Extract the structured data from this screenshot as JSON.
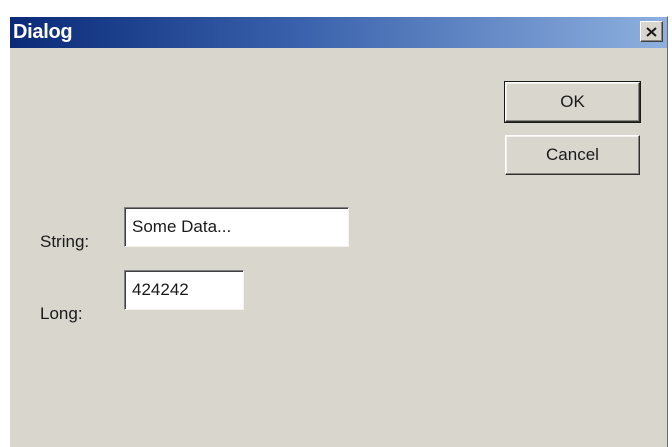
{
  "window": {
    "title": "Dialog"
  },
  "buttons": {
    "ok_label": "OK",
    "cancel_label": "Cancel"
  },
  "fields": {
    "string_label": "String:",
    "string_value": "Some Data...",
    "long_label": "Long:",
    "long_value": "424242"
  },
  "icons": {
    "close": "close-icon"
  },
  "colors": {
    "titlebar_start": "#0a2a78",
    "titlebar_end": "#8eb0df",
    "dialog_bg": "#d9d6ce"
  }
}
